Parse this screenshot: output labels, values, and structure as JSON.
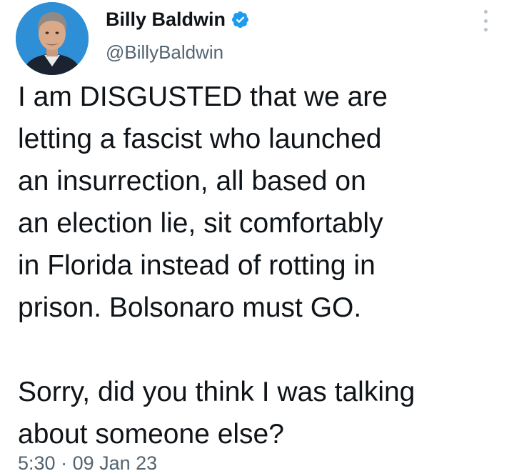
{
  "author": {
    "display_name": "Billy Baldwin",
    "handle": "@BillyBaldwin",
    "verified": true
  },
  "tweet": {
    "lines_paragraph_1": [
      "I am DISGUSTED that we are",
      "letting a fascist who launched",
      "an insurrection, all based on",
      "an election lie, sit comfortably",
      "in Florida instead of rotting in",
      "prison. Bolsonaro must GO."
    ],
    "lines_paragraph_2": [
      "Sorry, did you think I was talking",
      "about someone else?"
    ]
  },
  "meta": {
    "time": "5:30",
    "separator": "·",
    "date": "09 Jan 23"
  },
  "icons": {
    "verified": "verified-badge-icon",
    "more": "more-options-icon"
  },
  "colors": {
    "verified_blue": "#1d9bf0",
    "text": "#0f1419",
    "secondary_text": "#536471",
    "avatar_background": "#2f8fd6"
  }
}
